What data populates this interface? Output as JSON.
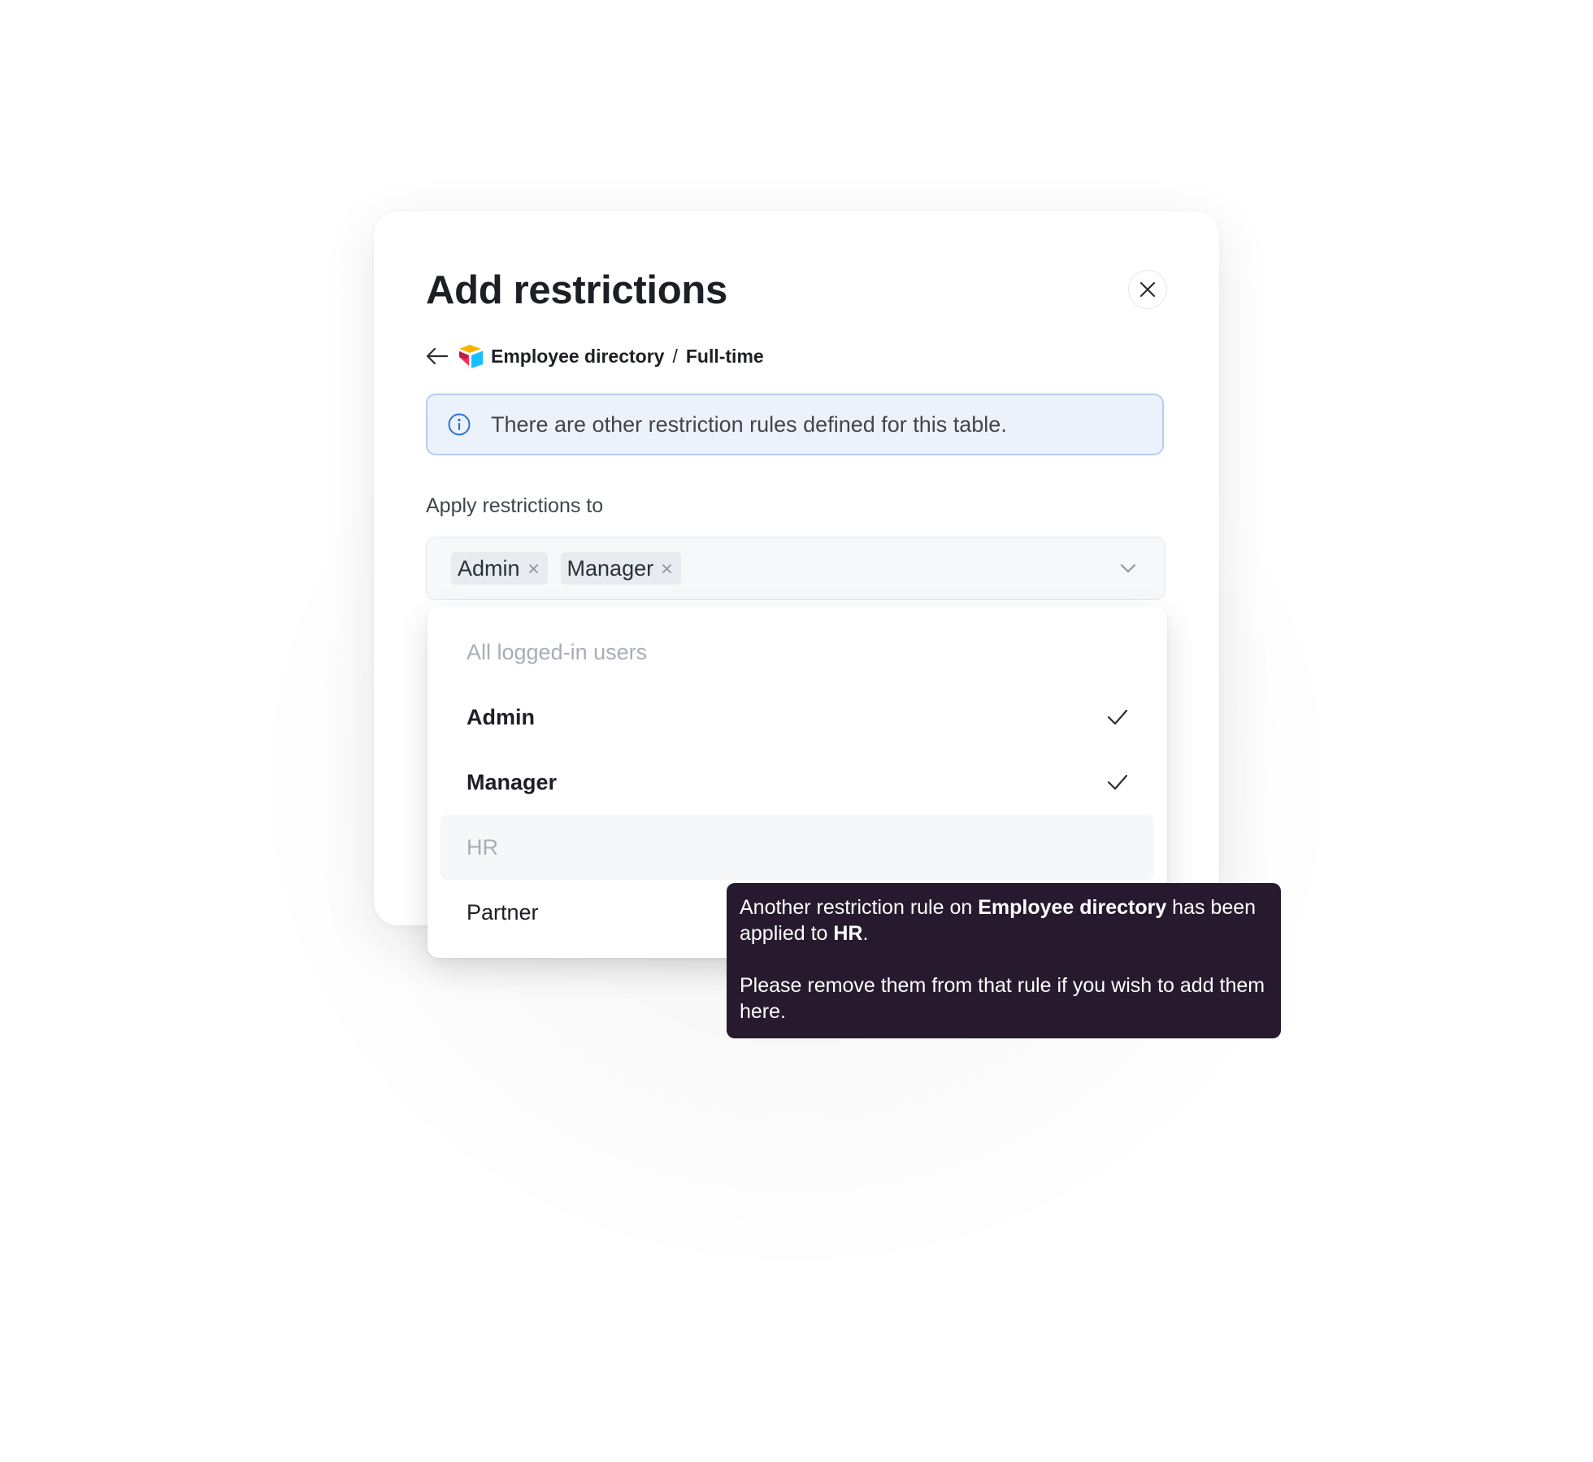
{
  "modal": {
    "title": "Add restrictions",
    "breadcrumb": {
      "table": "Employee directory",
      "separator": "/",
      "view": "Full-time"
    },
    "info_banner": {
      "text": "There are other restriction rules defined for this table."
    },
    "apply_label": "Apply restrictions to",
    "selected_tags": [
      {
        "label": "Admin"
      },
      {
        "label": "Manager"
      }
    ]
  },
  "dropdown": {
    "options": [
      {
        "label": "All logged-in users",
        "state": "disabled"
      },
      {
        "label": "Admin",
        "state": "selected"
      },
      {
        "label": "Manager",
        "state": "selected"
      },
      {
        "label": "HR",
        "state": "disabled-hovered"
      },
      {
        "label": "Partner",
        "state": "available"
      }
    ]
  },
  "tooltip": {
    "part1": "Another restriction rule on ",
    "bold1": "Employee directory",
    "part2": " has been applied to ",
    "bold2": "HR",
    "part3": ".",
    "line2": "Please remove them from that rule if you wish to add them here."
  },
  "colors": {
    "info_border": "#b7cdee",
    "info_background": "#ecf2fb",
    "info_icon": "#2d6fd2",
    "tooltip_background": "#271a2e",
    "disabled_text": "#a9adb5",
    "tag_background": "#e8ebf0"
  },
  "icons": {
    "close": "close-icon",
    "back": "arrow-left-icon",
    "table": "airtable-logo-icon",
    "info": "info-icon",
    "tag_remove": "close-icon",
    "chevron": "chevron-down-icon",
    "check": "check-icon"
  }
}
